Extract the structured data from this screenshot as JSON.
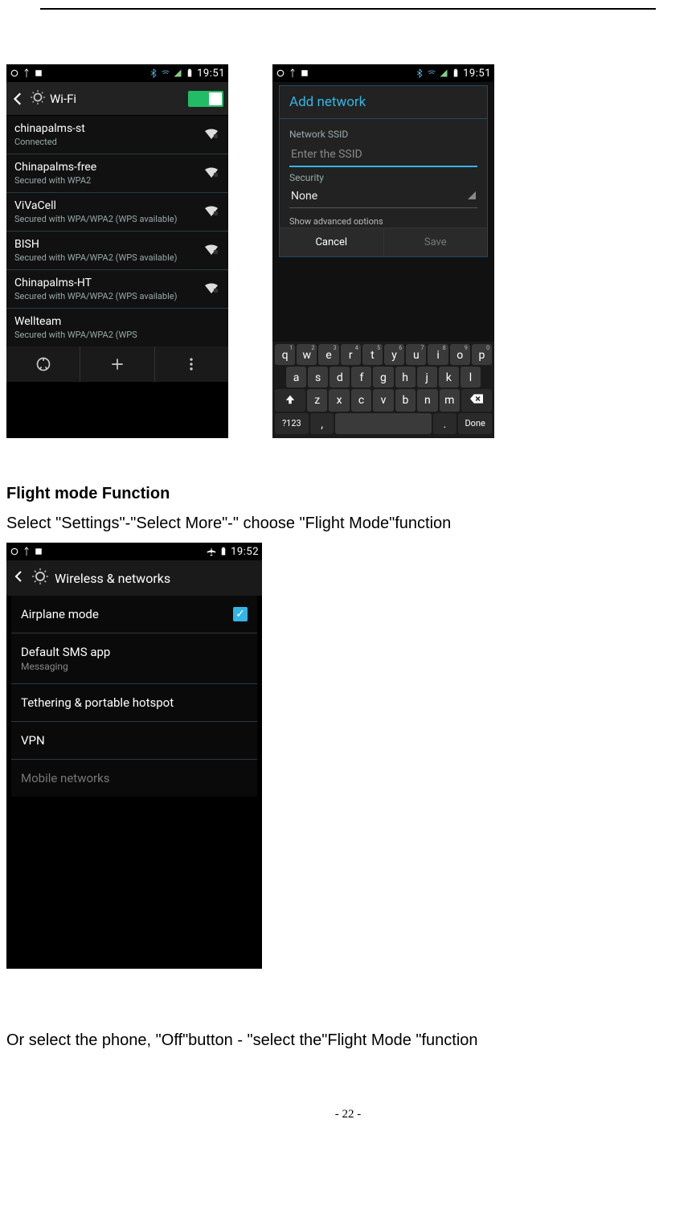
{
  "statusbar": {
    "time_a": "19:51",
    "time_b": "19:51",
    "time_c": "19:52"
  },
  "screen1": {
    "title": "Wi-Fi",
    "items": [
      {
        "ssid": "chinapalms-st",
        "sub": "Connected"
      },
      {
        "ssid": "Chinapalms-free",
        "sub": "Secured with WPA2"
      },
      {
        "ssid": "ViVaCell",
        "sub": "Secured with WPA/WPA2 (WPS available)"
      },
      {
        "ssid": "BISH",
        "sub": "Secured with WPA/WPA2 (WPS available)"
      },
      {
        "ssid": "Chinapalms-HT",
        "sub": "Secured with WPA/WPA2 (WPS available)"
      },
      {
        "ssid": "Wellteam",
        "sub": "Secured with WPA/WPA2 (WPS"
      }
    ]
  },
  "screen2": {
    "dialog_title": "Add network",
    "ssid_label": "Network SSID",
    "ssid_placeholder": "Enter the SSID",
    "security_label": "Security",
    "security_value": "None",
    "advanced_label": "Show advanced options",
    "cancel": "Cancel",
    "save": "Save",
    "kb_row1": [
      "q",
      "w",
      "e",
      "r",
      "t",
      "y",
      "u",
      "i",
      "o",
      "p"
    ],
    "kb_row1_sup": [
      "1",
      "2",
      "3",
      "4",
      "5",
      "6",
      "7",
      "8",
      "9",
      "0"
    ],
    "kb_row2": [
      "a",
      "s",
      "d",
      "f",
      "g",
      "h",
      "j",
      "k",
      "l"
    ],
    "kb_row3": [
      "z",
      "x",
      "c",
      "v",
      "b",
      "n",
      "m"
    ],
    "kb_row4": {
      "sym": "?123",
      "comma": ",",
      "dot": ".",
      "done": "Done"
    }
  },
  "section": {
    "heading": "Flight mode Function",
    "text": "Select \"Settings\"-\"Select More\"-\" choose \"Flight Mode\"function"
  },
  "screen3": {
    "title": "Wireless & networks",
    "items": [
      {
        "lbl": "Airplane mode",
        "checked": true
      },
      {
        "lbl": "Default SMS app",
        "sub": "Messaging"
      },
      {
        "lbl": "Tethering & portable hotspot"
      },
      {
        "lbl": "VPN"
      },
      {
        "lbl": "Mobile networks",
        "dim": true
      }
    ]
  },
  "after_text": "Or select the phone, \"Off\"button - \"select the\"Flight Mode \"function",
  "page_number": "- 22 -"
}
